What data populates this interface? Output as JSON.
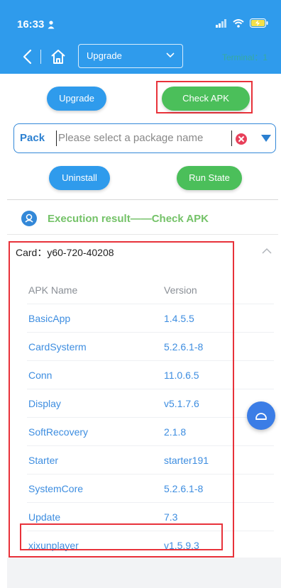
{
  "status_bar": {
    "time": "16:33"
  },
  "nav": {
    "select_value": "Upgrade",
    "terminal_label": "Terminal：1"
  },
  "actions": {
    "upgrade": "Upgrade",
    "check_apk": "Check APK",
    "uninstall": "Uninstall",
    "run_state": "Run State"
  },
  "pack": {
    "label": "Pack",
    "placeholder": "Please select a package name"
  },
  "execution": {
    "title": "Execution result——Check APK"
  },
  "card": {
    "label": "Card：",
    "id": "y60-720-40208"
  },
  "table": {
    "headers": {
      "name": "APK Name",
      "version": "Version"
    },
    "rows": [
      {
        "name": "BasicApp",
        "version": "1.4.5.5"
      },
      {
        "name": "CardSysterm",
        "version": "5.2.6.1-8"
      },
      {
        "name": "Conn",
        "version": "11.0.6.5"
      },
      {
        "name": "Display",
        "version": "v5.1.7.6"
      },
      {
        "name": "SoftRecovery",
        "version": "2.1.8"
      },
      {
        "name": "Starter",
        "version": "starter191"
      },
      {
        "name": "SystemCore",
        "version": "5.2.6.1-8"
      },
      {
        "name": "Update",
        "version": "7.3"
      },
      {
        "name": "xixunplayer",
        "version": "v1.5.9.3"
      }
    ]
  },
  "colors": {
    "header_blue": "#2f9bec",
    "green": "#4bbf5a",
    "highlight_red": "#e8323a",
    "link_blue": "#3d8de0"
  }
}
